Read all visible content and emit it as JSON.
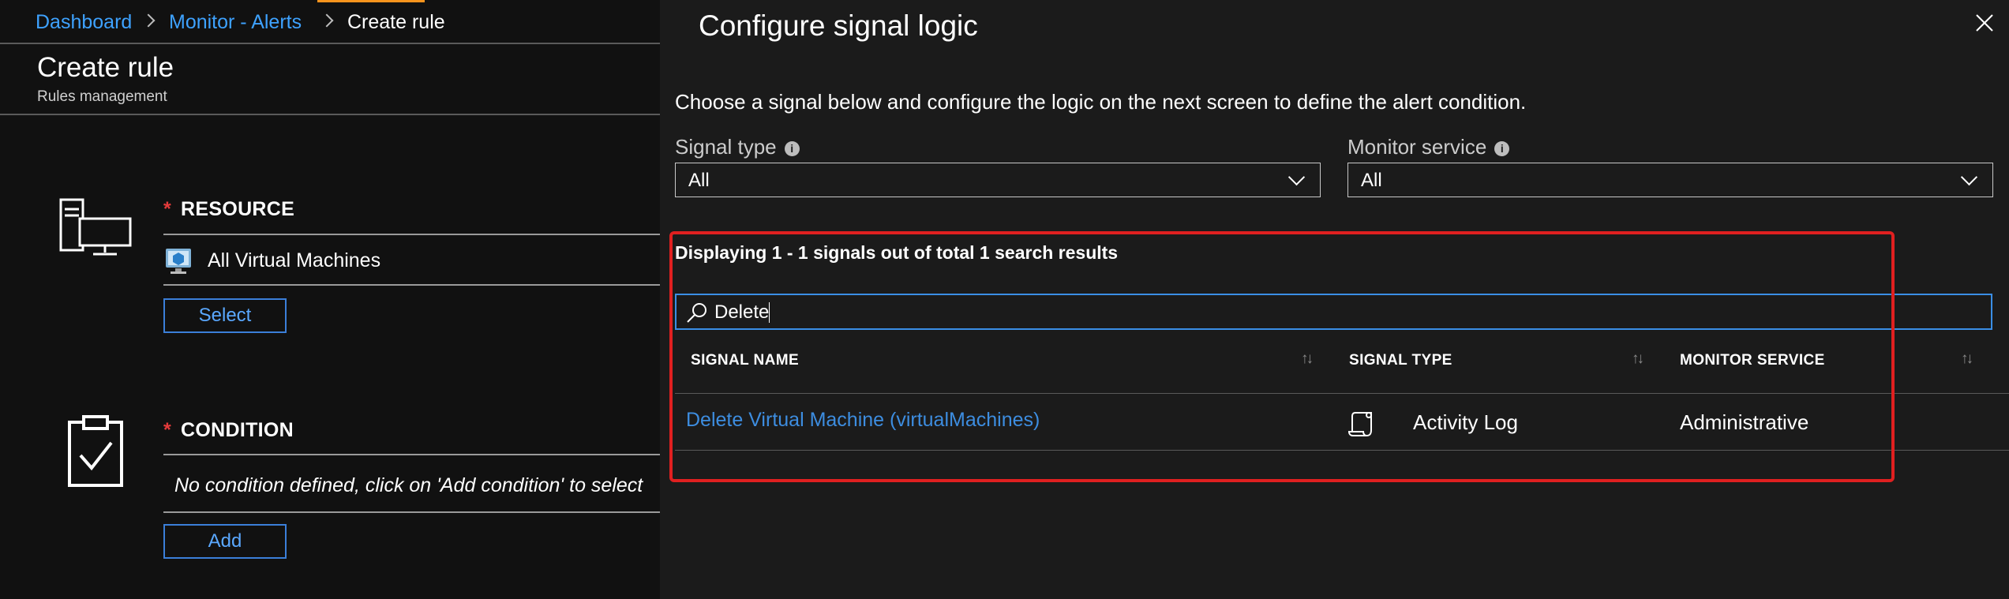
{
  "breadcrumb": [
    "Dashboard",
    "Monitor - Alerts",
    "Create rule"
  ],
  "page": {
    "title": "Create rule",
    "subtitle": "Rules management"
  },
  "resource": {
    "label": "RESOURCE",
    "required_marker": "*",
    "value": "All Virtual Machines",
    "button": "Select"
  },
  "condition": {
    "label": "CONDITION",
    "required_marker": "*",
    "placeholder": "No condition defined, click on 'Add condition' to select",
    "button": "Add"
  },
  "blade": {
    "title": "Configure signal logic",
    "instruction": "Choose a signal below and configure the logic on the next screen to define the alert condition."
  },
  "filters": {
    "signal_type": {
      "label": "Signal type",
      "value": "All"
    },
    "monitor_service": {
      "label": "Monitor service",
      "value": "All"
    }
  },
  "results": {
    "summary": "Displaying 1 - 1 signals out of total 1 search results",
    "search_value": "Delete",
    "columns": [
      "SIGNAL NAME",
      "SIGNAL TYPE",
      "MONITOR SERVICE"
    ],
    "rows": [
      {
        "signal_name": "Delete Virtual Machine (virtualMachines)",
        "signal_type": "Activity Log",
        "monitor_service": "Administrative"
      }
    ]
  },
  "colors": {
    "accent": "#f7941d",
    "link": "#3ea2ff",
    "highlight": "#e02020",
    "required": "#e43b3b"
  },
  "icons": [
    "chevron-right-icon",
    "computer-network-icon",
    "virtual-machine-icon",
    "clipboard-check-icon",
    "close-icon",
    "info-icon",
    "chevron-down-icon",
    "search-icon",
    "sort-icon",
    "activity-log-icon"
  ]
}
